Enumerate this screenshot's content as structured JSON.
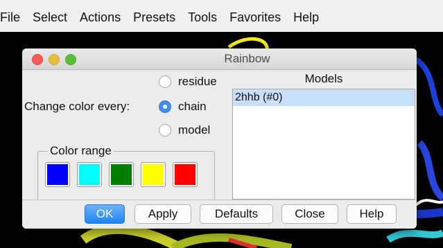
{
  "menubar": {
    "items": [
      "File",
      "Select",
      "Actions",
      "Presets",
      "Tools",
      "Favorites",
      "Help"
    ]
  },
  "dialog": {
    "title": "Rainbow",
    "change_label": "Change color every:",
    "options": [
      {
        "label": "residue",
        "selected": false
      },
      {
        "label": "chain",
        "selected": true
      },
      {
        "label": "model",
        "selected": false
      }
    ],
    "color_range": {
      "label": "Color range",
      "colors": [
        "#0000ff",
        "#00ffff",
        "#008000",
        "#ffff00",
        "#ff0000"
      ]
    },
    "models": {
      "header": "Models",
      "items": [
        "2hhb (#0)"
      ]
    },
    "buttons": {
      "ok": "OK",
      "apply": "Apply",
      "defaults": "Defaults",
      "close": "Close",
      "help": "Help"
    }
  }
}
